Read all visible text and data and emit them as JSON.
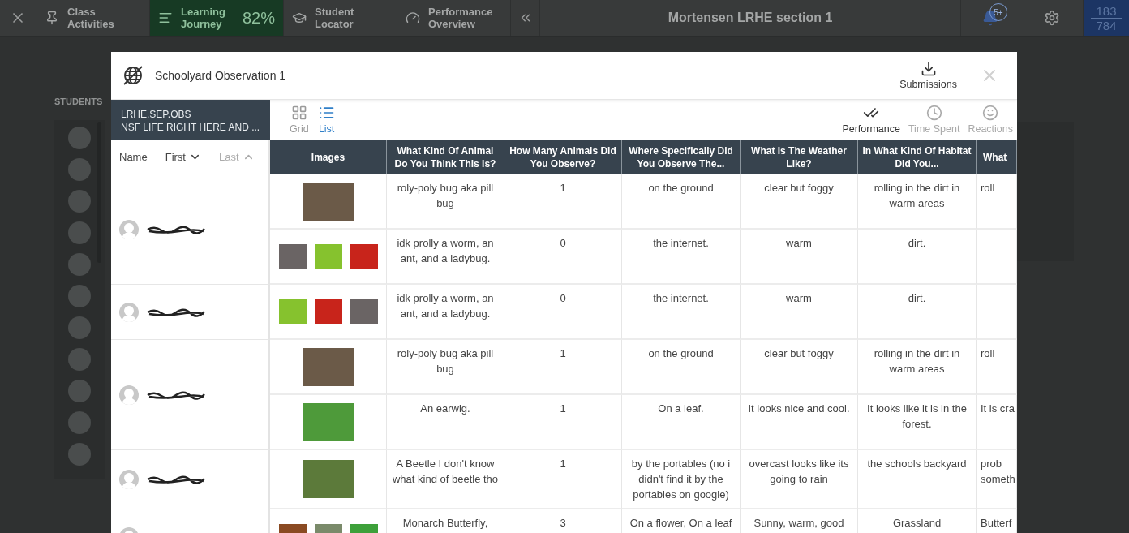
{
  "top_bar": {
    "nav_items": [
      {
        "label": "Class Activities",
        "selected": false
      },
      {
        "label": "Learning Journey",
        "selected": true,
        "progress": "82%"
      },
      {
        "label": "Student Locator",
        "selected": false
      },
      {
        "label": "Performance Overview",
        "selected": false
      }
    ],
    "title": "Mortensen LRHE section 1",
    "notification_badge": "5+",
    "score": {
      "earned": "183",
      "total": "784"
    }
  },
  "background": {
    "students_label": "STUDENTS"
  },
  "modal": {
    "title": "Schoolyard Observation 1",
    "submissions_button": "Submissions",
    "course": {
      "code": "LRHE.SEP.OBS",
      "name": "NSF LIFE RIGHT HERE AND ..."
    },
    "view_toggles": [
      {
        "label": "Grid",
        "selected": false
      },
      {
        "label": "List",
        "selected": true
      }
    ],
    "metrics": [
      {
        "label": "Performance",
        "selected": true
      },
      {
        "label": "Time Spent",
        "selected": false
      },
      {
        "label": "Reactions",
        "selected": false
      }
    ],
    "sort": {
      "label": "Name",
      "options": [
        {
          "label": "First",
          "selected": true
        },
        {
          "label": "Last",
          "selected": false
        }
      ]
    },
    "columns": [
      "Images",
      "What Kind Of Animal Do You Think This Is?",
      "How Many Animals Did You Observe?",
      "Where Specifically Did You Observe The...",
      "What Is The Weather Like?",
      "In What Kind Of Habitat Did You...",
      "What"
    ],
    "students": [
      {
        "submissions": [
          {
            "images": [
              {
                "color": "#6b5a48"
              }
            ],
            "answers": [
              "roly-poly bug aka pill bug",
              "1",
              "on the ground",
              "clear but foggy",
              "rolling in the dirt in warm areas",
              "roll"
            ]
          },
          {
            "images": [
              {
                "color": "#6a6464"
              },
              {
                "color": "#86c22e"
              },
              {
                "color": "#c8241b"
              }
            ],
            "answers": [
              "idk prolly a worm, an ant, and a ladybug.",
              "0",
              "the internet.",
              "warm",
              "dirt."
            ]
          }
        ]
      },
      {
        "submissions": [
          {
            "images": [
              {
                "color": "#86c22e"
              },
              {
                "color": "#c8241b"
              },
              {
                "color": "#6a6464"
              }
            ],
            "answers": [
              "idk prolly a worm, an ant, and a ladybug.",
              "0",
              "the internet.",
              "warm",
              "dirt."
            ]
          }
        ]
      },
      {
        "submissions": [
          {
            "images": [
              {
                "color": "#6b5a48"
              }
            ],
            "answers": [
              "roly-poly bug aka pill bug",
              "1",
              "on the ground",
              "clear but foggy",
              "rolling in the dirt in warm areas",
              "roll"
            ]
          },
          {
            "images": [
              {
                "color": "#4e9a3a"
              }
            ],
            "answers": [
              "An earwig.",
              "1",
              "On a leaf.",
              "It looks nice and cool.",
              "It looks like it is in the forest.",
              "It is cra"
            ]
          }
        ]
      },
      {
        "submissions": [
          {
            "images": [
              {
                "color": "#5c7a3a"
              }
            ],
            "answers": [
              "A Beetle I don't know what kind of beetle tho",
              "1",
              "by the portables (no i didn't find it by the portables on google)",
              "overcast looks like its going to rain",
              "the schools backyard",
              "prob\nsometh"
            ]
          }
        ]
      },
      {
        "submissions": [
          {
            "images": [
              {
                "color": "#8a4a22"
              },
              {
                "color": "#7a8a6a"
              },
              {
                "color": "#3da03a"
              }
            ],
            "answers": [
              "Monarch Butterfly,",
              "3",
              "On a flower, On a leaf",
              "Sunny, warm, good",
              "Grassland",
              "Butterf"
            ]
          }
        ]
      }
    ]
  }
}
